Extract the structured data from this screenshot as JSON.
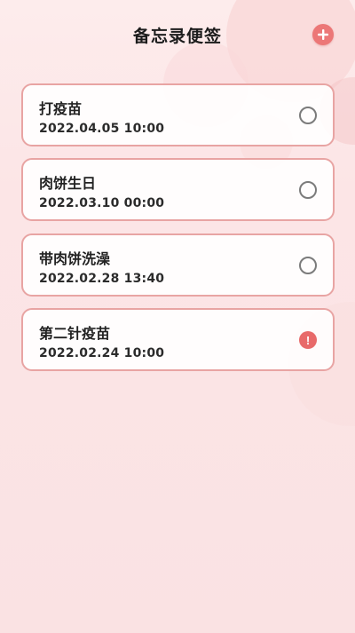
{
  "header": {
    "title": "备忘录便签",
    "add_icon": "plus-circle-icon",
    "accent_color": "#ec7777"
  },
  "memos": [
    {
      "title": "打疫苗",
      "time": "2022.04.05 10:00",
      "status": "pending",
      "status_icon": "empty-circle-icon"
    },
    {
      "title": "肉饼生日",
      "time": "2022.03.10 00:00",
      "status": "pending",
      "status_icon": "empty-circle-icon"
    },
    {
      "title": "带肉饼洗澡",
      "time": "2022.02.28 13:40",
      "status": "pending",
      "status_icon": "empty-circle-icon"
    },
    {
      "title": "第二针疫苗",
      "time": "2022.02.24 10:00",
      "status": "overdue",
      "status_icon": "exclamation-circle-icon"
    }
  ],
  "colors": {
    "card_border": "#e8a4a3",
    "alert": "#e86a6a",
    "background": "#fce5e6"
  }
}
